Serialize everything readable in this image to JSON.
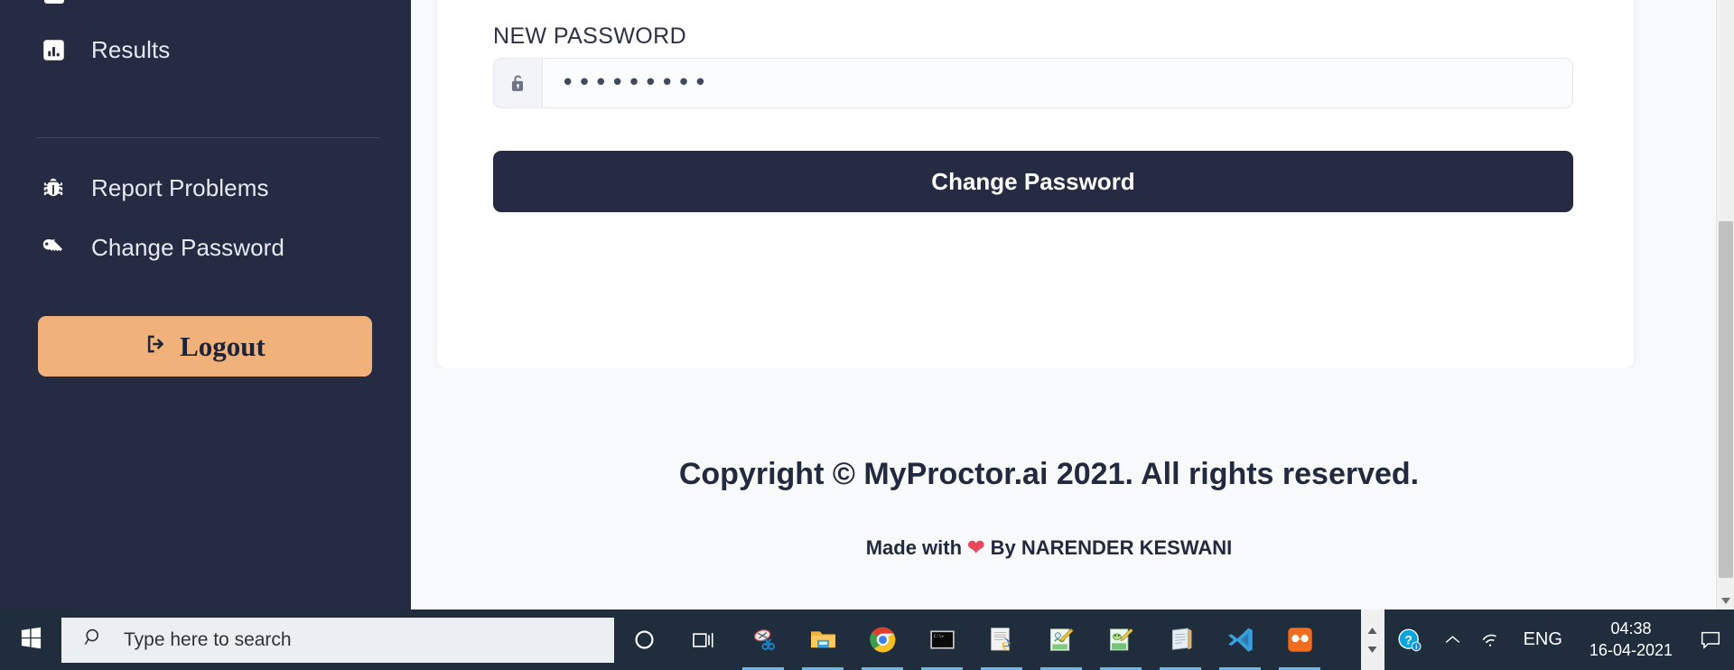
{
  "sidebar": {
    "items": [
      {
        "label": "Results",
        "icon": "chart-bar-icon"
      },
      {
        "label": "Report Problems",
        "icon": "bug-icon"
      },
      {
        "label": "Change Password",
        "icon": "key-icon"
      }
    ],
    "logout": {
      "label": "Logout",
      "icon": "logout-icon",
      "bg_color": "#f0b27a",
      "text_color": "#1d2439"
    },
    "bg_color": "#252b42"
  },
  "main": {
    "field_label": "NEW PASSWORD",
    "password_value": "•••••••••",
    "password_icon": "unlock-icon",
    "submit_label": "Change Password",
    "submit_bg_color": "#252b42"
  },
  "footer": {
    "copyright": "Copyright © MyProctor.ai 2021. All rights reserved.",
    "made_with_prefix": "Made with",
    "made_with_heart": "❤",
    "made_with_suffix": "By NARENDER KESWANI"
  },
  "taskbar": {
    "start_icon": "windows-logo-icon",
    "search_placeholder": "Type here to search",
    "search_icon": "search-icon",
    "items": [
      {
        "name": "cortana-icon"
      },
      {
        "name": "task-view-icon"
      },
      {
        "name": "snipping-tool-icon"
      },
      {
        "name": "file-explorer-icon"
      },
      {
        "name": "google-chrome-icon"
      },
      {
        "name": "command-prompt-icon"
      },
      {
        "name": "python-idle-icon"
      },
      {
        "name": "paint-icon"
      },
      {
        "name": "notepad-plus-plus-icon"
      },
      {
        "name": "notepad-icon"
      },
      {
        "name": "vs-code-icon"
      },
      {
        "name": "xampp-icon"
      }
    ],
    "tray": {
      "help_icon": "help-question-icon",
      "overflow_icon": "chevron-up-icon",
      "network_icon": "wifi-icon",
      "language": "ENG",
      "time": "04:38",
      "date": "16-04-2021",
      "notifications_icon": "action-center-icon"
    }
  }
}
